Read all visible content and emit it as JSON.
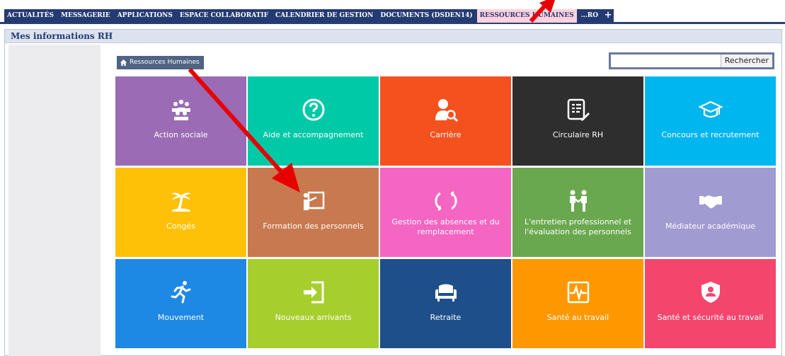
{
  "tabs": [
    {
      "label": "ACTUALITÉS",
      "active": false
    },
    {
      "label": "MESSAGERIE",
      "active": false
    },
    {
      "label": "APPLICATIONS",
      "active": false
    },
    {
      "label": "ESPACE COLLABORATIF",
      "active": false
    },
    {
      "label": "CALENDRIER DE GESTION",
      "active": false
    },
    {
      "label": "DOCUMENTS (DSDEN14)",
      "active": false
    },
    {
      "label": "RESSOURCES HUMAINES",
      "active": true
    },
    {
      "label": "…RO",
      "active": false
    }
  ],
  "add_tab_label": "+",
  "panel_title": "Mes informations RH",
  "breadcrumb": {
    "label": "Ressources Humaines",
    "icon": "home-icon"
  },
  "search": {
    "value": "",
    "placeholder": "",
    "button_label": "Rechercher"
  },
  "tiles": [
    {
      "label": "Action sociale",
      "color": "#9b6cb5",
      "icon": "people-group-icon"
    },
    {
      "label": "Aide et accompagnement",
      "color": "#00c9a7",
      "icon": "question-circle-icon"
    },
    {
      "label": "Carrière",
      "color": "#f4511e",
      "icon": "user-search-icon"
    },
    {
      "label": "Circulaire RH",
      "color": "#2e2e2e",
      "icon": "document-edit-icon"
    },
    {
      "label": "Concours et recrutement",
      "color": "#00b6ef",
      "icon": "graduation-cap-icon"
    },
    {
      "label": "Congés",
      "color": "#ffc107",
      "icon": "palm-tree-icon"
    },
    {
      "label": "Formation des personnels",
      "color": "#c8794f",
      "icon": "teacher-board-icon"
    },
    {
      "label": "Gestion des absences et du remplacement",
      "color": "#f565c2",
      "icon": "refresh-circle-icon"
    },
    {
      "label": "L'entretien professionnel et l'évaluation des personnels",
      "color": "#6aa84f",
      "icon": "two-people-icon"
    },
    {
      "label": "Médiateur académique",
      "color": "#a09bd0",
      "icon": "handshake-icon"
    },
    {
      "label": "Mouvement",
      "color": "#1e88e5",
      "icon": "running-person-icon"
    },
    {
      "label": "Nouveaux arrivants",
      "color": "#a6cf2e",
      "icon": "sign-in-icon"
    },
    {
      "label": "Retraite",
      "color": "#1e4f8b",
      "icon": "armchair-icon"
    },
    {
      "label": "Santé au travail",
      "color": "#ff9800",
      "icon": "heartbeat-monitor-icon"
    },
    {
      "label": "Santé et sécurité au travail",
      "color": "#f4466d",
      "icon": "shield-user-icon"
    }
  ],
  "annotation_color": "#e60000"
}
